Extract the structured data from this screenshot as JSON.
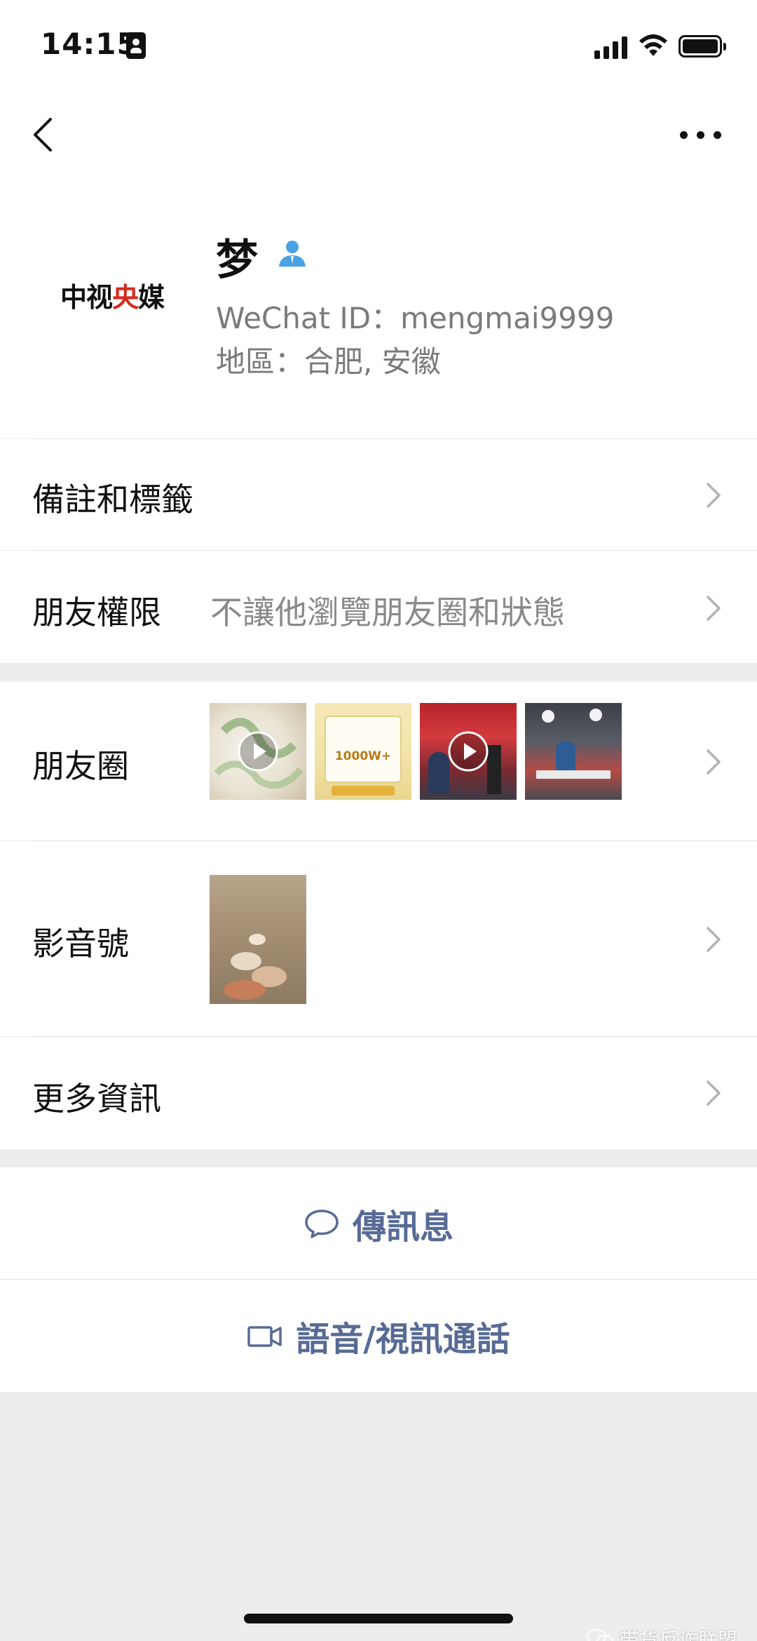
{
  "status_bar": {
    "time": "14:15"
  },
  "profile": {
    "avatar_text_left": "中视",
    "avatar_text_accent": "央",
    "avatar_text_right": "媒",
    "nickname": "梦",
    "wechat_id": "WeChat ID：mengmai9999",
    "region": "地區：合肥, 安徽"
  },
  "rows": {
    "remarks": {
      "label": "備註和標籤"
    },
    "permissions": {
      "label": "朋友權限",
      "value": "不讓他瀏覽朋友圈和狀態"
    },
    "moments": {
      "label": "朋友圈"
    },
    "channels": {
      "label": "影音號"
    },
    "more_info": {
      "label": "更多資訊"
    }
  },
  "actions": {
    "message": "傳訊息",
    "call": "語音/視訊通話"
  },
  "moments_thumbs": {
    "thumb2_text": "1000W+"
  },
  "watermark": "带货反诈联盟",
  "colors": {
    "link": "#576b95",
    "accent_red": "#d42a1c",
    "user_icon_blue": "#4aa1e4",
    "background": "#ededed"
  }
}
